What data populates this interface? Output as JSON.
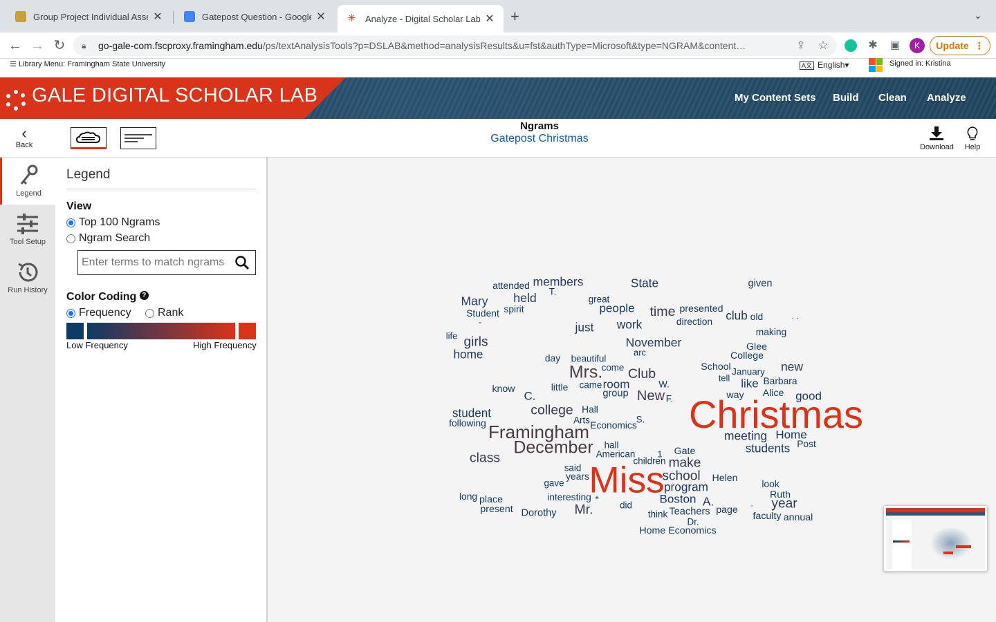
{
  "browser": {
    "tabs": [
      {
        "title": "Group Project Individual Assess",
        "favicon_color": "#c8a13a"
      },
      {
        "title": "Gatepost Question - Google Do",
        "favicon_color": "#4285f4"
      },
      {
        "title": "Analyze - Digital Scholar Lab",
        "favicon_color": "#d9331a"
      }
    ],
    "url_host": "go-gale-com.fscproxy.framingham.edu",
    "url_path": "/ps/textAnalysisTools?p=DSLAB&method=analysisResults&u=fst&authType=Microsoft&type=NGRAM&content…",
    "profile_initial": "K",
    "update_label": "Update"
  },
  "library_bar": {
    "menu_label": "Library Menu: Framingham State University",
    "language": "English",
    "signed_in": "Signed in: Kristina"
  },
  "header": {
    "brand": "GALE DIGITAL SCHOLAR LAB",
    "nav": [
      "My Content Sets",
      "Build",
      "Clean",
      "Analyze"
    ]
  },
  "toolbar": {
    "back_label": "Back",
    "title": "Ngrams",
    "subtitle": "Gatepost Christmas",
    "download_label": "Download",
    "help_label": "Help"
  },
  "rail": {
    "items": [
      "Legend",
      "Tool Setup",
      "Run History"
    ]
  },
  "legend": {
    "heading": "Legend",
    "view_heading": "View",
    "view_options": [
      "Top 100 Ngrams",
      "Ngram Search"
    ],
    "search_placeholder": "Enter terms to match ngrams",
    "color_heading": "Color Coding",
    "color_options": [
      "Frequency",
      "Rank"
    ],
    "low_label": "Low Frequency",
    "high_label": "High Frequency",
    "colors": {
      "low": "#0d3a66",
      "high": "#d9331a"
    }
  },
  "wordcloud": [
    {
      "t": "Christmas",
      "f": 1.0
    },
    {
      "t": "Miss",
      "f": 0.95
    },
    {
      "t": "Framingham",
      "f": 0.55
    },
    {
      "t": "December",
      "f": 0.5
    },
    {
      "t": "Mrs.",
      "f": 0.5
    },
    {
      "t": "New",
      "f": 0.35
    },
    {
      "t": "Club",
      "f": 0.3
    },
    {
      "t": "time",
      "f": 0.3
    },
    {
      "t": "college",
      "f": 0.28
    },
    {
      "t": "class",
      "f": 0.28
    },
    {
      "t": "Mr.",
      "f": 0.28
    },
    {
      "t": "school",
      "f": 0.25
    },
    {
      "t": "make",
      "f": 0.25
    },
    {
      "t": "year",
      "f": 0.25
    },
    {
      "t": "girls",
      "f": 0.25
    },
    {
      "t": "held",
      "f": 0.22
    },
    {
      "t": "Mary",
      "f": 0.2
    },
    {
      "t": "meeting",
      "f": 0.2
    },
    {
      "t": "members",
      "f": 0.2
    },
    {
      "t": "November",
      "f": 0.2
    },
    {
      "t": "new",
      "f": 0.2
    },
    {
      "t": "just",
      "f": 0.18
    },
    {
      "t": "work",
      "f": 0.18
    },
    {
      "t": "A.",
      "f": 0.18
    },
    {
      "t": "program",
      "f": 0.17
    },
    {
      "t": "State",
      "f": 0.17
    },
    {
      "t": "home",
      "f": 0.17
    },
    {
      "t": "club",
      "f": 0.17
    },
    {
      "t": "students",
      "f": 0.16
    },
    {
      "t": "student",
      "f": 0.16
    },
    {
      "t": "Home",
      "f": 0.15
    },
    {
      "t": "good",
      "f": 0.15
    },
    {
      "t": "Boston",
      "f": 0.15
    },
    {
      "t": "people",
      "f": 0.15
    },
    {
      "t": "C.",
      "f": 0.15
    },
    {
      "t": "room",
      "f": 0.15
    },
    {
      "t": "like",
      "f": 0.15
    },
    {
      "t": "group",
      "f": 0.14
    },
    {
      "t": "given",
      "f": 0.14
    },
    {
      "t": "Dorothy",
      "f": 0.14
    },
    {
      "t": "Teachers",
      "f": 0.14
    },
    {
      "t": "Home Economics",
      "f": 0.13
    },
    {
      "t": "presented",
      "f": 0.13
    },
    {
      "t": "know",
      "f": 0.13
    },
    {
      "t": "School",
      "f": 0.13
    },
    {
      "t": "Gate",
      "f": 0.13
    },
    {
      "t": "place",
      "f": 0.13
    },
    {
      "t": "present",
      "f": 0.13
    },
    {
      "t": "Helen",
      "f": 0.13
    },
    {
      "t": "Ruth",
      "f": 0.13
    },
    {
      "t": "annual",
      "f": 0.13
    },
    {
      "t": "faculty",
      "f": 0.13
    },
    {
      "t": "page",
      "f": 0.13
    },
    {
      "t": "way",
      "f": 0.13
    },
    {
      "t": "Alice",
      "f": 0.13
    },
    {
      "t": "College",
      "f": 0.13
    },
    {
      "t": "Glee",
      "f": 0.13
    },
    {
      "t": "making",
      "f": 0.12
    },
    {
      "t": "attended",
      "f": 0.12
    },
    {
      "t": "direction",
      "f": 0.12
    },
    {
      "t": "interesting",
      "f": 0.12
    },
    {
      "t": "years",
      "f": 0.12
    },
    {
      "t": "little",
      "f": 0.12
    },
    {
      "t": "Barbara",
      "f": 0.12
    },
    {
      "t": "Hall",
      "f": 0.12
    },
    {
      "t": "day",
      "f": 0.12
    },
    {
      "t": "Student",
      "f": 0.12
    },
    {
      "t": "spirit",
      "f": 0.12
    },
    {
      "t": "following",
      "f": 0.12
    },
    {
      "t": "Economics",
      "f": 0.12
    },
    {
      "t": "old",
      "f": 0.12
    },
    {
      "t": "long",
      "f": 0.12
    },
    {
      "t": "Post",
      "f": 0.12
    },
    {
      "t": "look",
      "f": 0.12
    },
    {
      "t": "great",
      "f": 0.11
    },
    {
      "t": "beautiful",
      "f": 0.11
    },
    {
      "t": "come",
      "f": 0.11
    },
    {
      "t": "came",
      "f": 0.11
    },
    {
      "t": "American",
      "f": 0.11
    },
    {
      "t": "children",
      "f": 0.11
    },
    {
      "t": "hall",
      "f": 0.11
    },
    {
      "t": "Arts",
      "f": 0.11
    },
    {
      "t": "January",
      "f": 0.11
    },
    {
      "t": "gave",
      "f": 0.11
    },
    {
      "t": "said",
      "f": 0.11
    },
    {
      "t": "think",
      "f": 0.11
    },
    {
      "t": "did",
      "f": 0.11
    },
    {
      "t": "Dr.",
      "f": 0.11
    },
    {
      "t": "W.",
      "f": 0.11
    },
    {
      "t": "F.",
      "f": 0.11
    },
    {
      "t": "S.",
      "f": 0.11
    },
    {
      "t": "T.",
      "f": 0.11
    },
    {
      "t": "arc",
      "f": 0.1
    },
    {
      "t": "tell",
      "f": 0.1
    },
    {
      "t": "life",
      "f": 0.1
    },
    {
      "t": "1",
      "f": 0.1
    },
    {
      "t": "-",
      "f": 0.1
    },
    {
      "t": "*",
      "f": 0.1
    },
    {
      "t": ". .",
      "f": 0.1
    },
    {
      "t": ".",
      "f": 0.1
    }
  ]
}
